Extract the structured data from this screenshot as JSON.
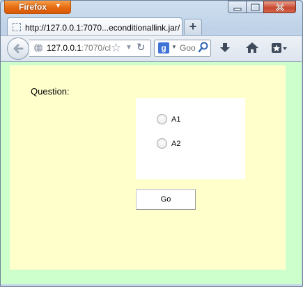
{
  "browser": {
    "menu_button_label": "Firefox",
    "tab_title": "http://127.0.0.1:7070...econditionallink.jar/",
    "new_tab_label": "+",
    "address_host": "127.0.0.1",
    "address_rest": ":7070/cl",
    "search_placeholder": "Goo",
    "search_engine_label": "g"
  },
  "page": {
    "background": "#ffffcc",
    "viewport_background": "#ccffcc",
    "question_label": "Question:",
    "answers": [
      {
        "label": "A1"
      },
      {
        "label": "A2"
      }
    ],
    "go_button_label": "Go"
  },
  "icons": {
    "window": [
      "minimize-icon",
      "maximize-icon",
      "close-icon"
    ],
    "nav": [
      "back-icon",
      "globe-icon",
      "bookmark-star-icon",
      "history-dropdown-icon",
      "reload-icon",
      "search-engine-icon",
      "search-icon",
      "download-icon",
      "home-icon",
      "bookmarks-menu-icon"
    ]
  }
}
